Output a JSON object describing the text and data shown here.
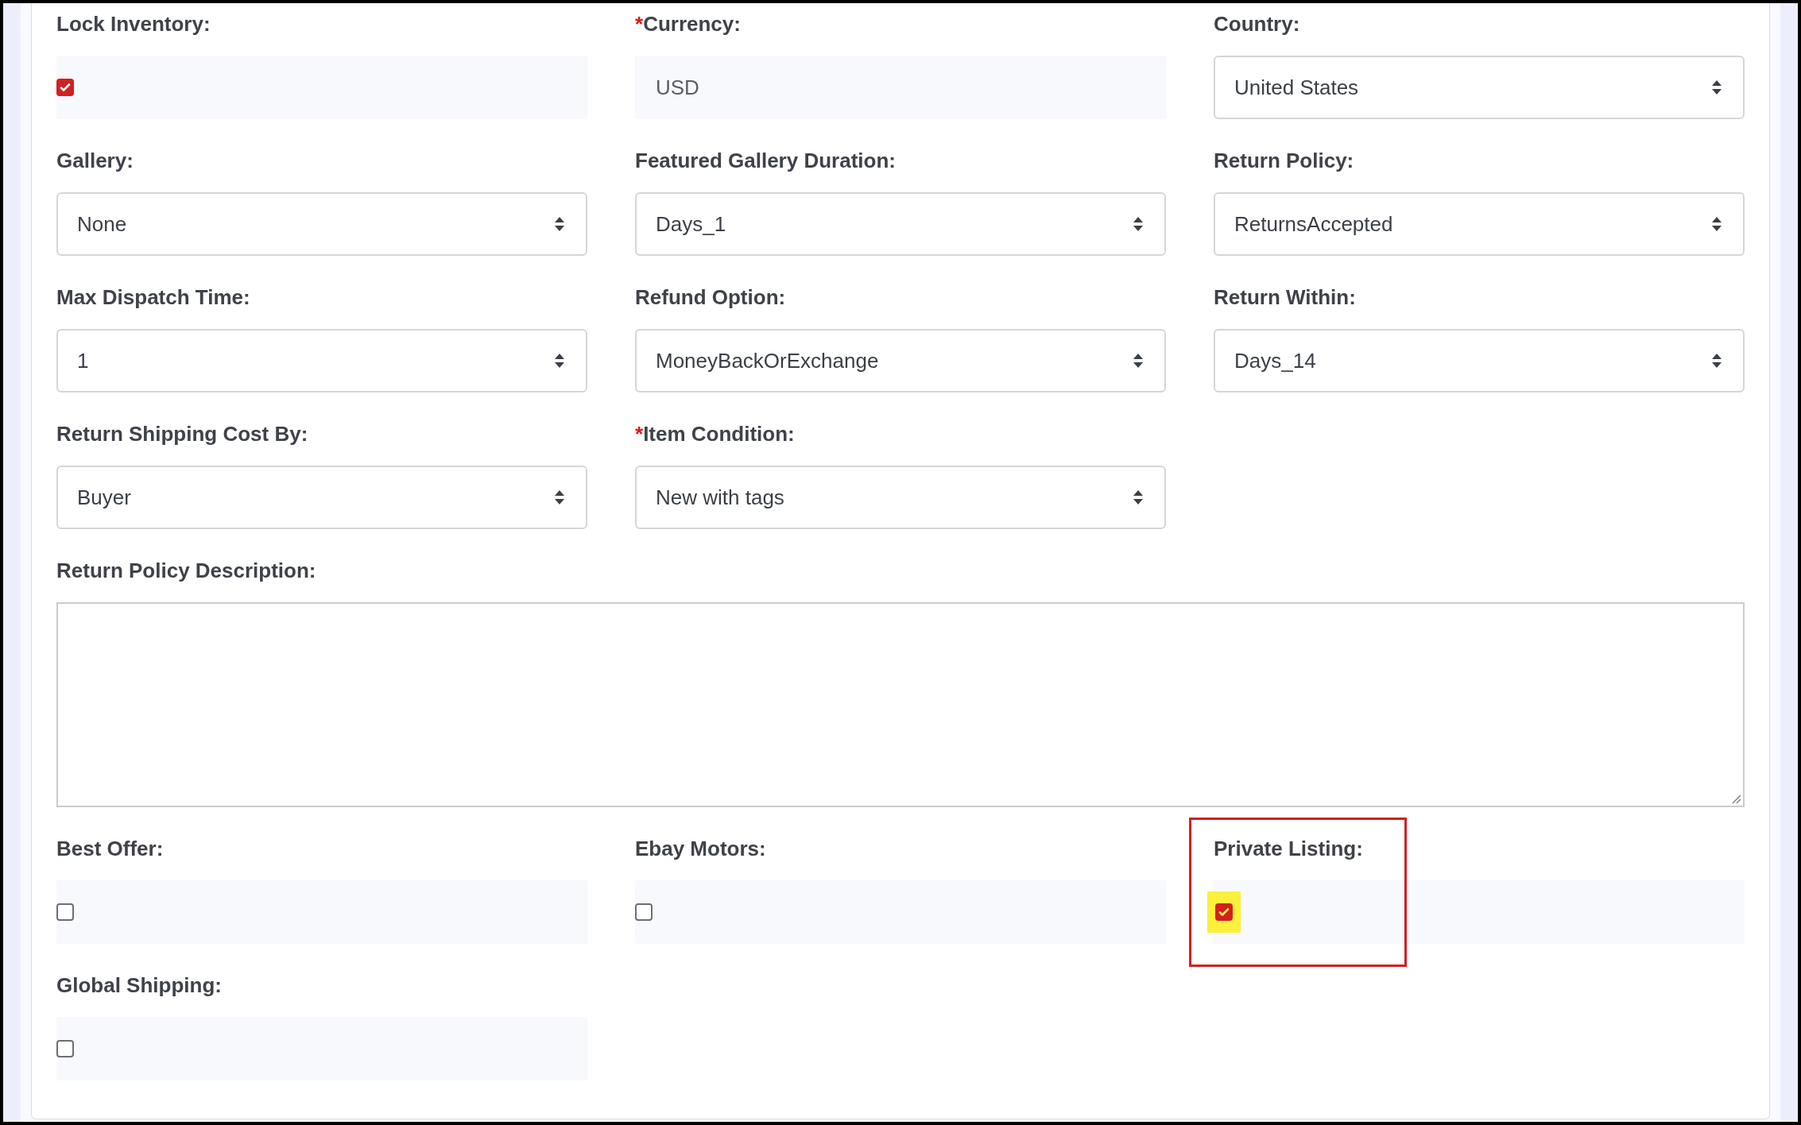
{
  "fields": [
    {
      "kind": "checkbox",
      "label": "Lock Inventory:",
      "checked": true,
      "highlighted": false
    },
    {
      "kind": "readonly",
      "required_mark": "*",
      "label": "Currency:",
      "value": "USD",
      "highlighted": false
    },
    {
      "kind": "select",
      "label": "Country:",
      "value": "United States",
      "highlighted": false
    },
    {
      "kind": "select",
      "label": "Gallery:",
      "value": "None",
      "highlighted": false
    },
    {
      "kind": "select",
      "label": "Featured Gallery Duration:",
      "value": "Days_1",
      "highlighted": false
    },
    {
      "kind": "select",
      "label": "Return Policy:",
      "value": "ReturnsAccepted",
      "highlighted": false
    },
    {
      "kind": "select",
      "label": "Max Dispatch Time:",
      "value": "1",
      "highlighted": false
    },
    {
      "kind": "select",
      "label": "Refund Option:",
      "value": "MoneyBackOrExchange",
      "highlighted": false
    },
    {
      "kind": "select",
      "label": "Return Within:",
      "value": "Days_14",
      "highlighted": false
    },
    {
      "kind": "select",
      "label": "Return Shipping Cost By:",
      "value": "Buyer",
      "highlighted": false
    },
    {
      "kind": "select",
      "required_mark": "*",
      "label": "Item Condition:",
      "value": "New with tags",
      "highlighted": false
    },
    {
      "kind": "textarea",
      "label": "Return Policy Description:",
      "highlighted": false
    },
    {
      "kind": "checkbox",
      "label": "Best Offer:",
      "checked": false,
      "highlighted": false
    },
    {
      "kind": "checkbox",
      "label": "Ebay Motors:",
      "checked": false,
      "highlighted": false
    },
    {
      "kind": "checkbox",
      "label": "Private Listing:",
      "checked": true,
      "highlighted": true
    },
    {
      "kind": "checkbox",
      "label": "Global Shipping:",
      "checked": false,
      "highlighted": false
    }
  ]
}
